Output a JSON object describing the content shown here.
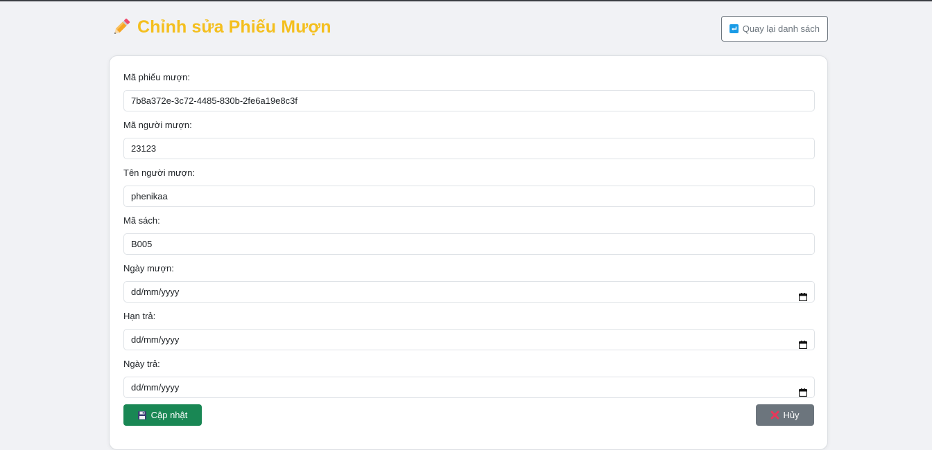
{
  "header": {
    "title": "Chỉnh sửa Phiếu Mượn",
    "back_button": "Quay lại danh sách"
  },
  "form": {
    "fields": [
      {
        "label": "Mã phiếu mượn:",
        "value": "7b8a372e-3c72-4485-830b-2fe6a19e8c3f"
      },
      {
        "label": "Mã người mượn:",
        "value": "23123"
      },
      {
        "label": "Tên người mượn:",
        "value": "phenikaa"
      },
      {
        "label": "Mã sách:",
        "value": "B005"
      },
      {
        "label": "Ngày mượn:",
        "value": "dd/mm/yyyy"
      },
      {
        "label": "Hạn trả:",
        "value": "dd/mm/yyyy"
      },
      {
        "label": "Ngày trả:",
        "value": "dd/mm/yyyy"
      }
    ],
    "update_button": "Cập nhật",
    "cancel_button": "Hủy"
  },
  "colors": {
    "title": "#f4bf1e",
    "update_button": "#198754",
    "cancel_button": "#6c757d",
    "back_icon": "#1a9be6",
    "cancel_x": "#e8375a"
  }
}
